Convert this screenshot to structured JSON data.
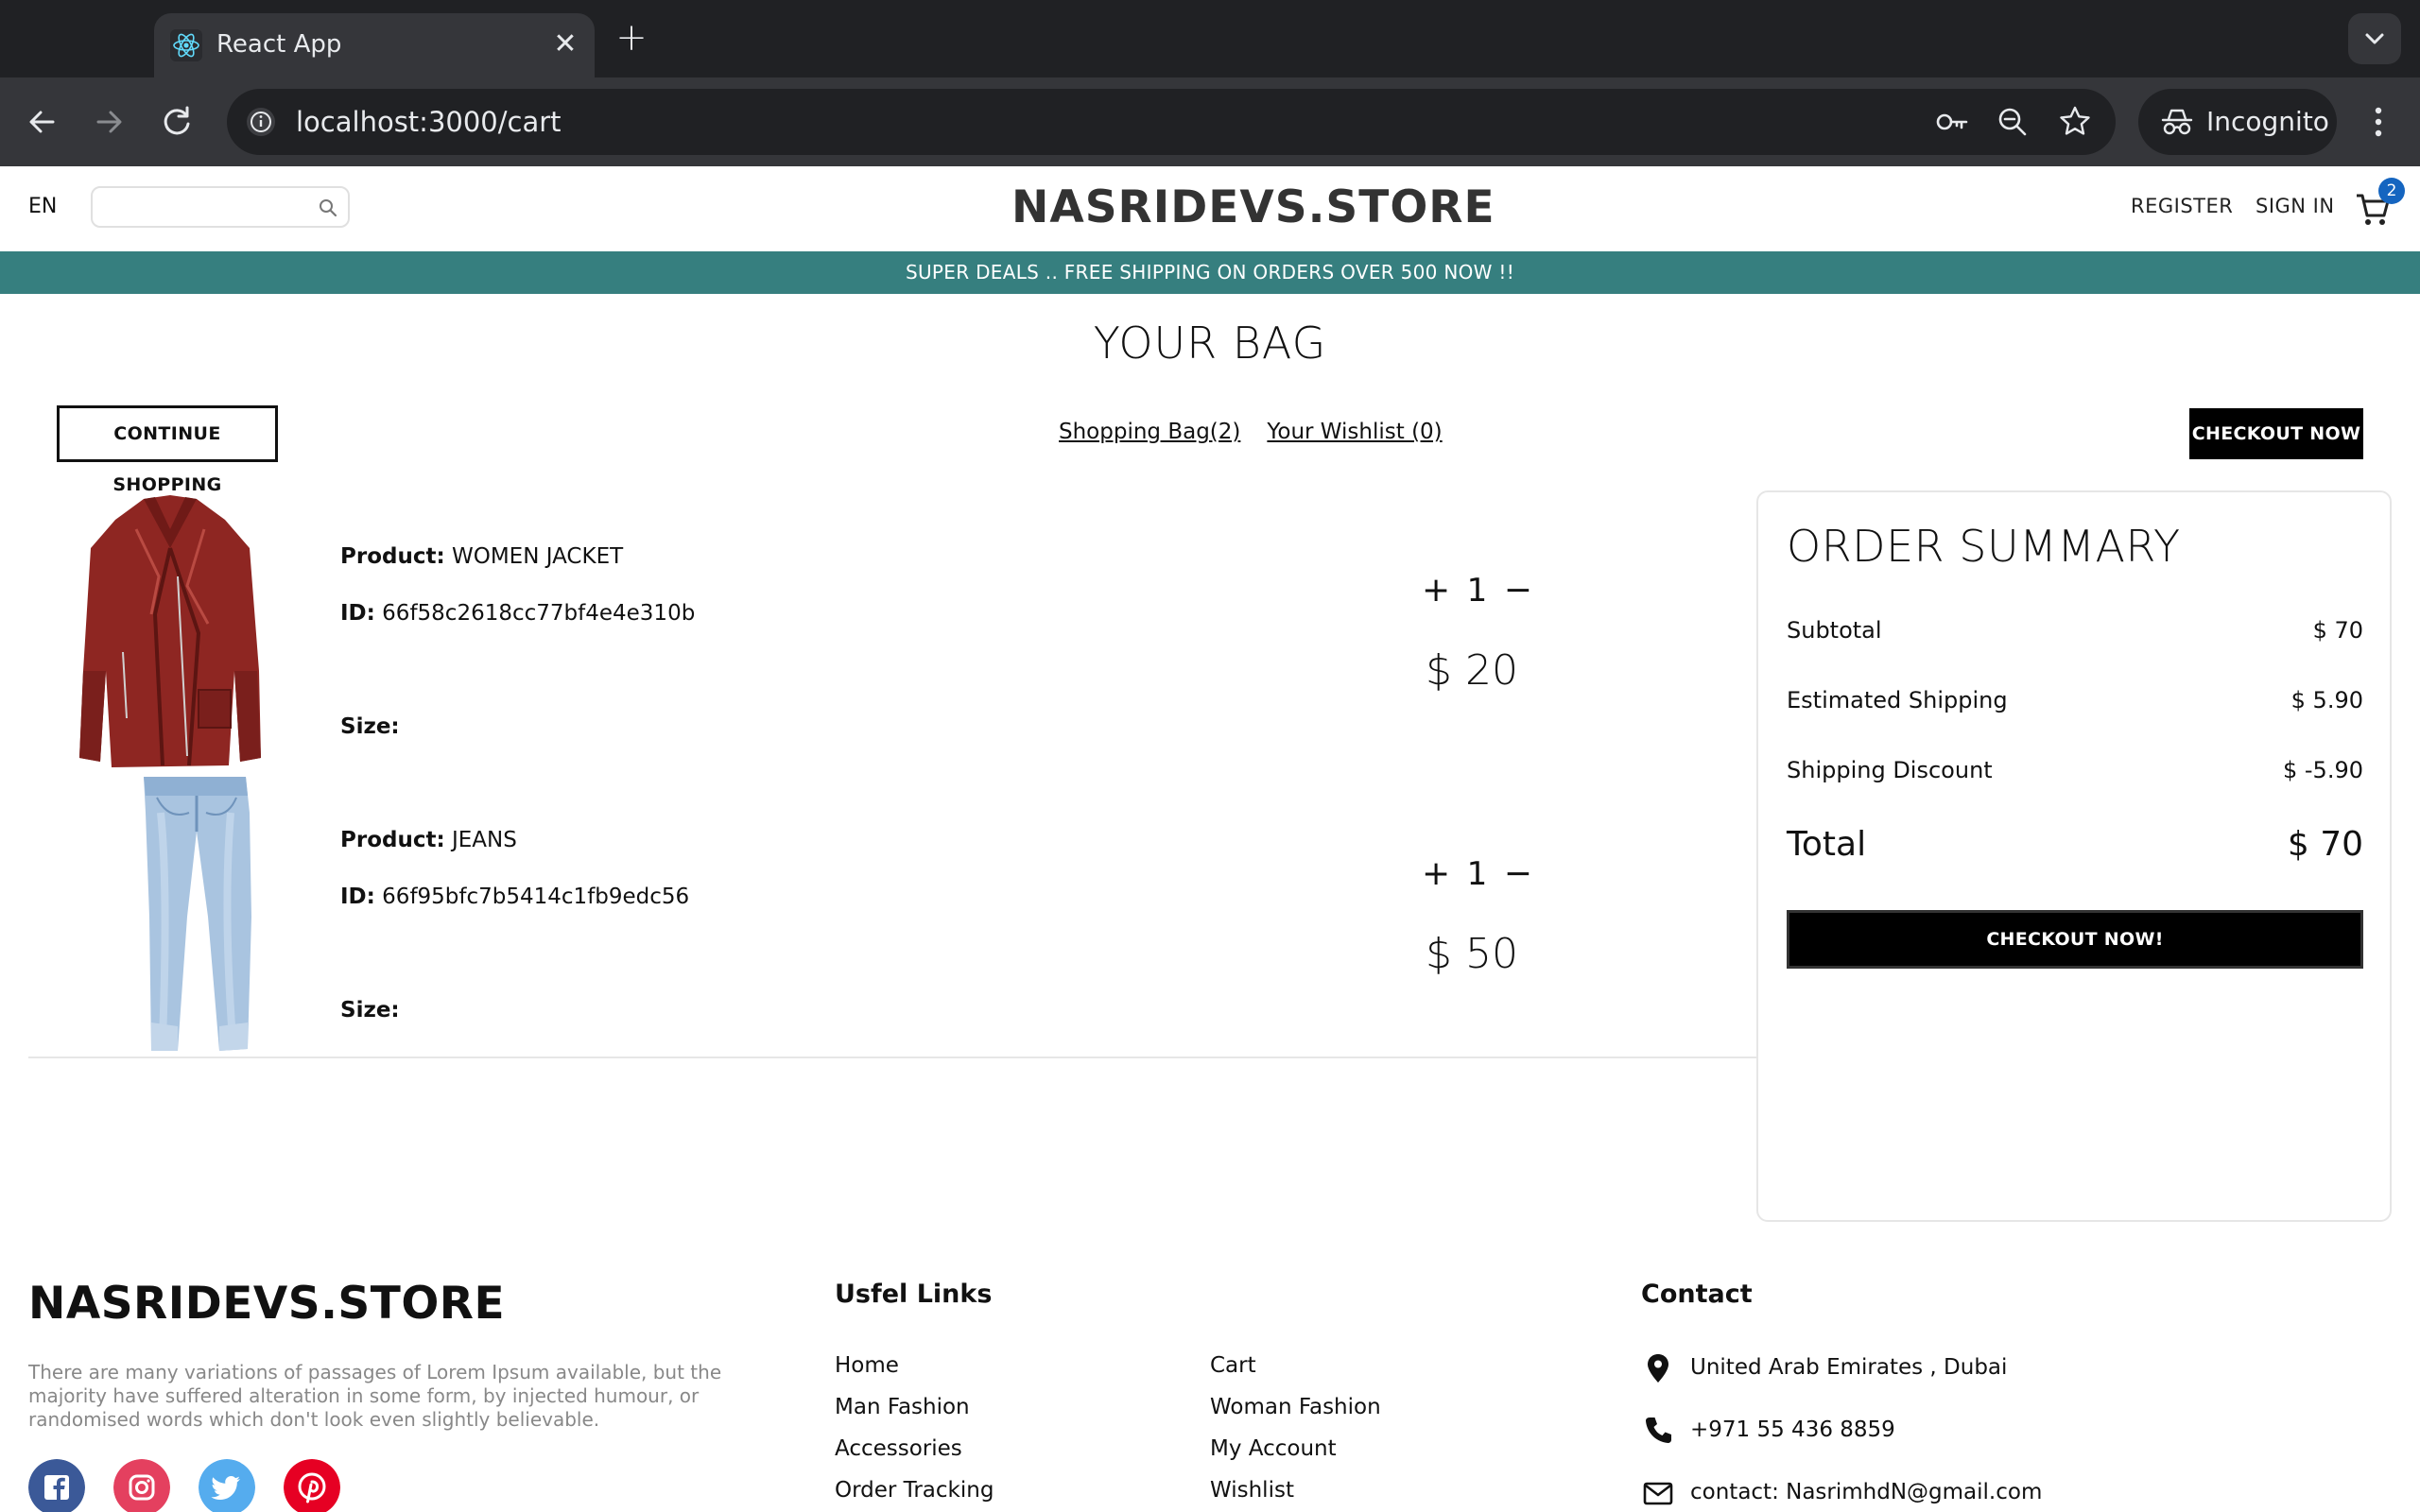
{
  "browser": {
    "tab_title": "React App",
    "url": "localhost:3000/cart",
    "profile_label": "Incognito"
  },
  "header": {
    "language": "EN",
    "search_placeholder": "",
    "logo": "NASRIDEVS.STORE",
    "register": "REGISTER",
    "sign_in": "SIGN IN",
    "cart_count": "2"
  },
  "announcement": "SUPER DEALS .. FREE SHIPPING ON ORDERS OVER 500 NOW !!",
  "cart_page": {
    "title": "YOUR BAG",
    "continue_button": "CONTINUE SHOPPING",
    "shopping_bag_link": "Shopping Bag(2)",
    "wishlist_link": "Your Wishlist (0)",
    "checkout_button": "CHECKOUT NOW",
    "labels": {
      "product": "Product:",
      "id": "ID:",
      "size": "Size:"
    },
    "items": [
      {
        "product": "WOMEN JACKET",
        "id": "66f58c2618cc77bf4e4e310b",
        "size": "",
        "quantity": "1",
        "price": "$ 20",
        "image": "red-leather-jacket"
      },
      {
        "product": "JEANS",
        "id": "66f95bfc7b5414c1fb9edc56",
        "size": "",
        "quantity": "1",
        "price": "$ 50",
        "image": "light-blue-jeans"
      }
    ]
  },
  "summary": {
    "title": "ORDER SUMMARY",
    "rows": [
      {
        "label": "Subtotal",
        "value": "$ 70"
      },
      {
        "label": "Estimated Shipping",
        "value": "$ 5.90"
      },
      {
        "label": "Shipping Discount",
        "value": "$ -5.90"
      }
    ],
    "total_label": "Total",
    "total_value": "$ 70",
    "checkout_button": "CHECKOUT NOW!"
  },
  "footer": {
    "logo": "NASRIDEVS.STORE",
    "description": "There are many variations of passages of Lorem Ipsum available, but the majority have suffered alteration in some form, by injected humour, or randomised words which don't look even slightly believable.",
    "social": [
      {
        "name": "facebook-icon",
        "color": "#3b5998"
      },
      {
        "name": "instagram-icon",
        "color": "#e4405f"
      },
      {
        "name": "twitter-icon",
        "color": "#55acee"
      },
      {
        "name": "pinterest-icon",
        "color": "#e60023"
      }
    ],
    "links_heading": "Usfel Links",
    "links": [
      "Home",
      "Cart",
      "Man Fashion",
      "Woman Fashion",
      "Accessories",
      "My Account",
      "Order Tracking",
      "Wishlist"
    ],
    "contact_heading": "Contact",
    "contact": {
      "address": "United Arab Emirates , Dubai",
      "phone": "+971 55 436 8859",
      "email": "contact: NasrimhdN@gmail.com"
    }
  },
  "colors": {
    "announcement_bg": "#367f7f",
    "cart_badge": "#1565c0"
  }
}
